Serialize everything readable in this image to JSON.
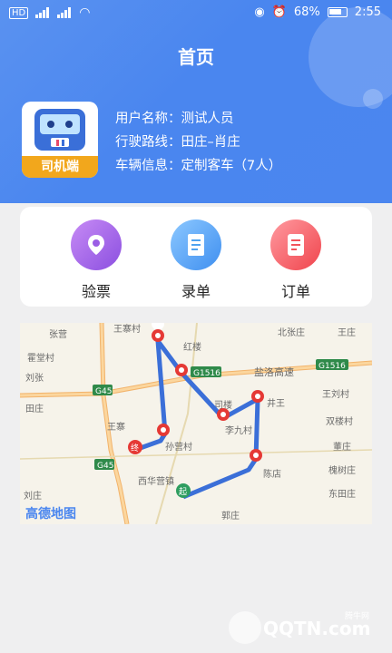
{
  "status_bar": {
    "left_text": "HD",
    "signal1": "4G",
    "signal2": "4G",
    "battery": "68%",
    "time": "2:55"
  },
  "header": {
    "title": "首页"
  },
  "profile": {
    "avatar_tag": "司机端",
    "rows": [
      {
        "label": "用户名称：",
        "value": "测试人员"
      },
      {
        "label": "行驶路线：",
        "value": "田庄–肖庄"
      },
      {
        "label": "车辆信息：",
        "value": "定制客车（7人）"
      }
    ]
  },
  "actions": [
    {
      "label": "验票",
      "icon": "ticket-check-icon",
      "color": "#9b5de5"
    },
    {
      "label": "录单",
      "icon": "record-icon",
      "color": "#4fa3f0"
    },
    {
      "label": "订单",
      "icon": "order-icon",
      "color": "#f2555b"
    }
  ],
  "map": {
    "brand": "高德地图",
    "places": [
      "张营",
      "霍堂村",
      "刘张",
      "田庄",
      "王寨",
      "红楼",
      "北张庄",
      "王庄",
      "井王",
      "王刘村",
      "双楼村",
      "董庄",
      "槐树庄",
      "东田庄",
      "陈店",
      "西华营镇",
      "郭庄",
      "孙营村",
      "李九村",
      "司楼",
      "刘庄",
      "王寨村"
    ],
    "roads": [
      "G45",
      "G1516",
      "盐洛高速",
      "G45",
      "G1516"
    ],
    "start_label": "起",
    "end_label": "终"
  },
  "watermark": {
    "text": "QQTN.com",
    "site": "腾牛网"
  }
}
